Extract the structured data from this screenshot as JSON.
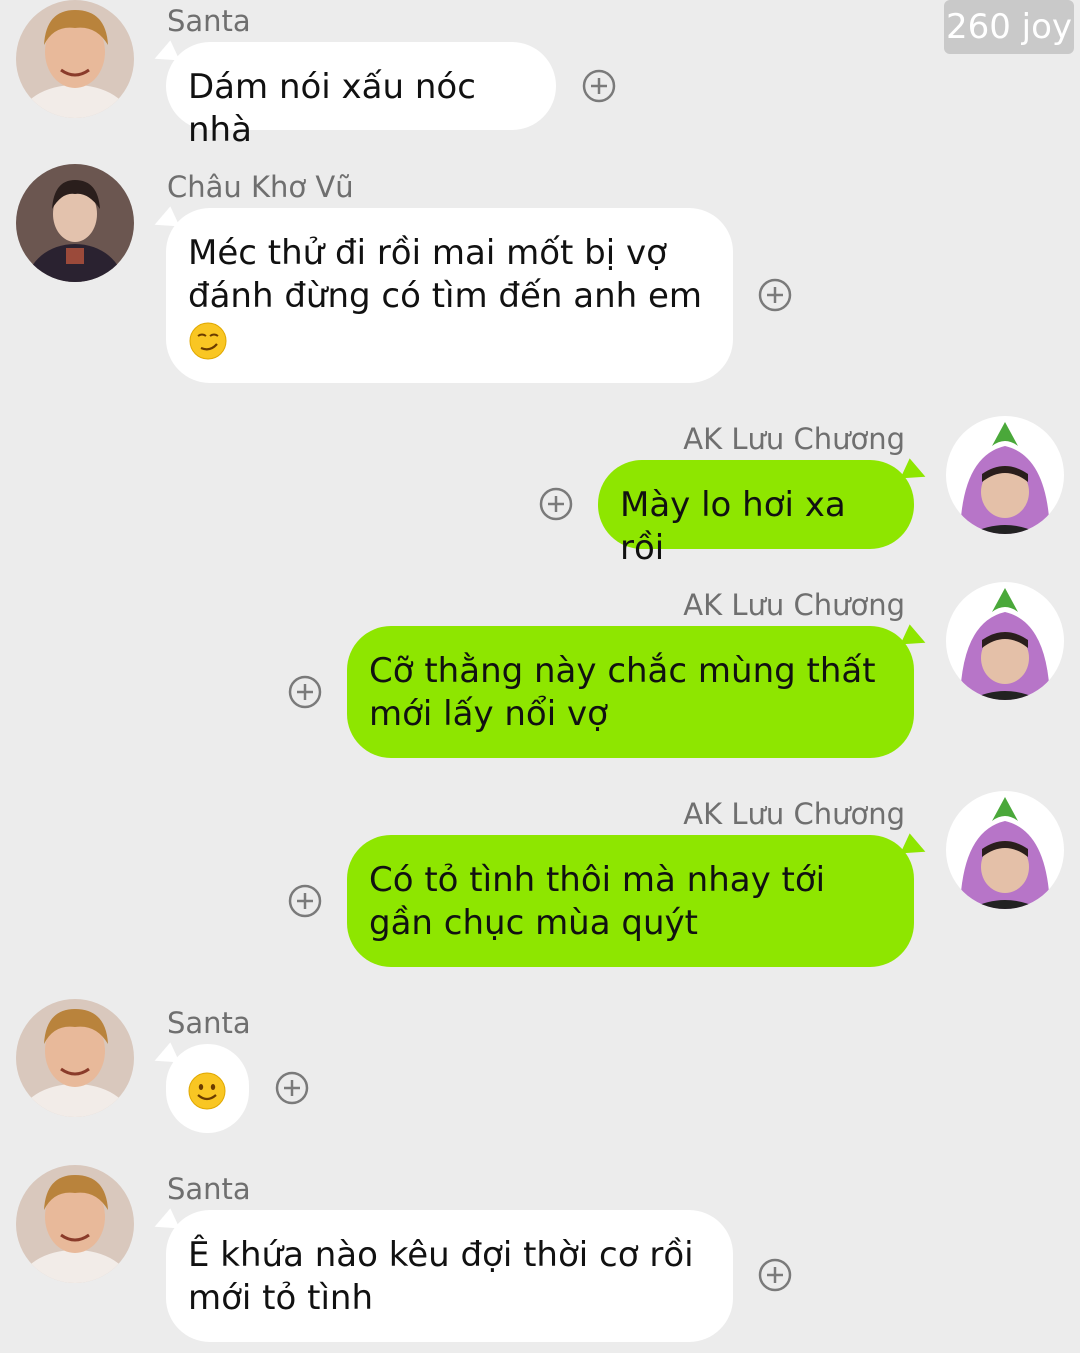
{
  "watermark": "260 joy",
  "messages": [
    {
      "sender": "Santa",
      "text": "Dám nói xấu nóc nhà",
      "direction": "incoming"
    },
    {
      "sender": "Châu Khơ Vũ",
      "text": "Méc thử đi rồi mai mốt bị vợ đánh đừng có tìm đến anh em",
      "emoji": "smirking-face",
      "direction": "incoming"
    },
    {
      "sender": "AK Lưu Chương",
      "text": "Mày lo hơi xa rồi",
      "direction": "outgoing"
    },
    {
      "sender": "AK Lưu Chương",
      "text": "Cỡ thằng này chắc mùng thất mới lấy nổi vợ",
      "direction": "outgoing"
    },
    {
      "sender": "AK Lưu Chương",
      "text": "Có tỏ tình thôi mà nhay tới gần chục mùa quýt",
      "direction": "outgoing"
    },
    {
      "sender": "Santa",
      "text": "",
      "emoji": "slightly-smiling-face",
      "direction": "incoming"
    },
    {
      "sender": "Santa",
      "text": "Ê khứa nào kêu đợi thời cơ rồi mới tỏ tình",
      "direction": "incoming"
    }
  ],
  "colors": {
    "background": "#ececec",
    "incoming_bubble": "#ffffff",
    "outgoing_bubble": "#8ee600",
    "sender_name": "#6f6f6f"
  }
}
